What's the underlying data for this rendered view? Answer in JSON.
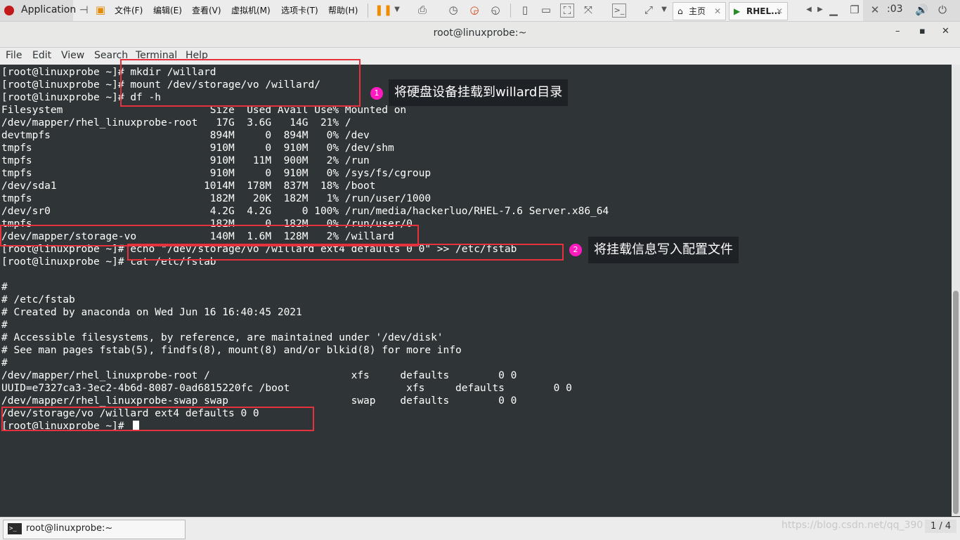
{
  "host": {
    "applications": "Application",
    "menus": [
      "文件(F)",
      "编辑(E)",
      "查看(V)",
      "虚拟机(M)",
      "选项卡(T)",
      "帮助(H)"
    ],
    "tabs": [
      "主页",
      "RHEL..."
    ],
    "clock": ":03"
  },
  "window": {
    "title": "root@linuxprobe:~",
    "buttons": [
      "–",
      "▪",
      "✕"
    ]
  },
  "terminal_menu": [
    "File",
    "Edit",
    "View",
    "Search",
    "Terminal",
    "Help"
  ],
  "terminal_lines": [
    "[root@linuxprobe ~]# mkdir /willard",
    "[root@linuxprobe ~]# mount /dev/storage/vo /willard/",
    "[root@linuxprobe ~]# df -h",
    "Filesystem                        Size  Used Avail Use% Mounted on",
    "/dev/mapper/rhel_linuxprobe-root   17G  3.6G   14G  21% /",
    "devtmpfs                          894M     0  894M   0% /dev",
    "tmpfs                             910M     0  910M   0% /dev/shm",
    "tmpfs                             910M   11M  900M   2% /run",
    "tmpfs                             910M     0  910M   0% /sys/fs/cgroup",
    "/dev/sda1                        1014M  178M  837M  18% /boot",
    "tmpfs                             182M   20K  182M   1% /run/user/1000",
    "/dev/sr0                          4.2G  4.2G     0 100% /run/media/hackerluo/RHEL-7.6 Server.x86_64",
    "tmpfs                             182M     0  182M   0% /run/user/0",
    "/dev/mapper/storage-vo            140M  1.6M  128M   2% /willard",
    "[root@linuxprobe ~]# echo \"/dev/storage/vo /willard ext4 defaults 0 0\" >> /etc/fstab",
    "[root@linuxprobe ~]# cat /etc/fstab",
    "",
    "#",
    "# /etc/fstab",
    "# Created by anaconda on Wed Jun 16 16:40:45 2021",
    "#",
    "# Accessible filesystems, by reference, are maintained under '/dev/disk'",
    "# See man pages fstab(5), findfs(8), mount(8) and/or blkid(8) for more info",
    "#",
    "/dev/mapper/rhel_linuxprobe-root /                       xfs     defaults        0 0",
    "UUID=e7327ca3-3ec2-4b6d-8087-0ad6815220fc /boot                   xfs     defaults        0 0",
    "/dev/mapper/rhel_linuxprobe-swap swap                    swap    defaults        0 0",
    "/dev/storage/vo /willard ext4 defaults 0 0",
    "[root@linuxprobe ~]# "
  ],
  "annotations": [
    {
      "number": "1",
      "text": "将硬盘设备挂载到willard目录"
    },
    {
      "number": "2",
      "text": "将挂载信息写入配置文件"
    }
  ],
  "taskbar": {
    "item": "root@linuxprobe:~",
    "watermark": "https://blog.csdn.net/qq_390",
    "pager": "1 / 4"
  }
}
